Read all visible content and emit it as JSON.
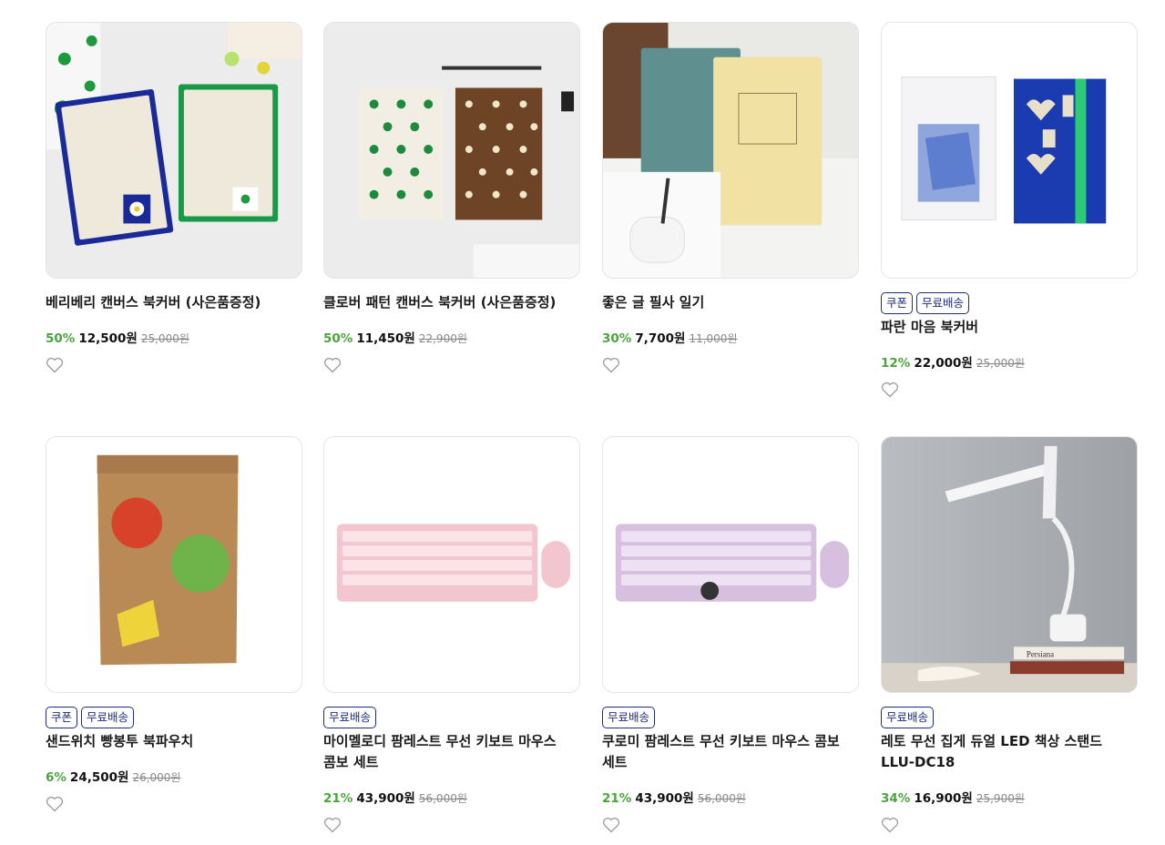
{
  "products": [
    {
      "title": "베리베리 캔버스 북커버 (사은품증정)",
      "badges": [],
      "discount": "50%",
      "price": "12,500원",
      "original": "25,000원",
      "image": "canvas-bookcover-green"
    },
    {
      "title": "클로버 패턴 캔버스 북커버 (사은품증정)",
      "badges": [],
      "discount": "50%",
      "price": "11,450원",
      "original": "22,900원",
      "image": "clover-bookcover"
    },
    {
      "title": "좋은 글 필사 일기",
      "badges": [],
      "discount": "30%",
      "price": "7,700원",
      "original": "11,000원",
      "image": "writing-diary"
    },
    {
      "title": "파란 마음 북커버",
      "badges": [
        "쿠폰",
        "무료배송"
      ],
      "discount": "12%",
      "price": "22,000원",
      "original": "25,000원",
      "image": "blue-heart-bookcover"
    },
    {
      "title": "샌드위치 빵봉투 북파우치",
      "badges": [
        "쿠폰",
        "무료배송"
      ],
      "discount": "6%",
      "price": "24,500원",
      "original": "26,000원",
      "image": "paper-bag-pouch"
    },
    {
      "title": "마이멜로디 팜레스트 무선 키보트 마우스 콤보 세트",
      "badges": [
        "무료배송"
      ],
      "discount": "21%",
      "price": "43,900원",
      "original": "56,000원",
      "image": "pink-keyboard"
    },
    {
      "title": "쿠로미 팜레스트 무선 키보트 마우스 콤보 세트",
      "badges": [
        "무료배송"
      ],
      "discount": "21%",
      "price": "43,900원",
      "original": "56,000원",
      "image": "purple-keyboard"
    },
    {
      "title": "레토 무선 집게 듀얼 LED 책상 스탠드 LLU-DC18",
      "badges": [
        "무료배송"
      ],
      "discount": "34%",
      "price": "16,900원",
      "original": "25,900원",
      "image": "led-desk-lamp"
    }
  ],
  "book_label": "Persiana",
  "icons": {
    "wishlist": "heart-outline-icon"
  },
  "colors": {
    "discount": "#4aa53b",
    "badge": "#1d2f7a"
  }
}
